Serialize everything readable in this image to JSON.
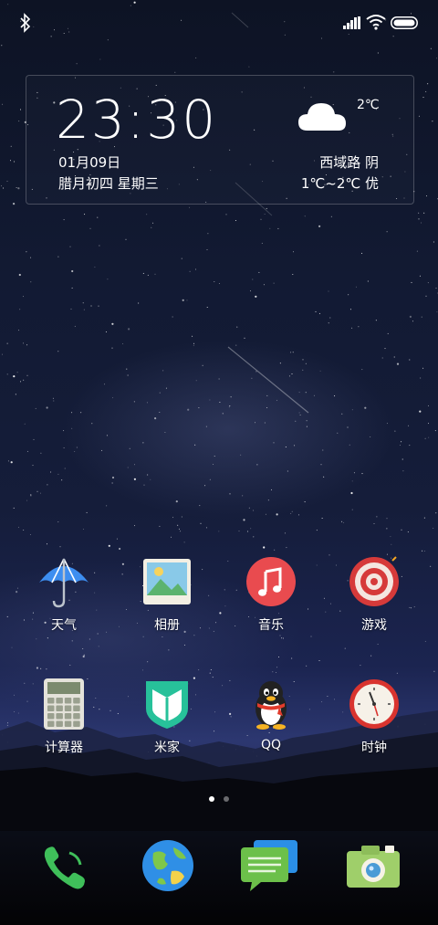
{
  "status_bar": {
    "bluetooth_icon": "bluetooth-icon",
    "signal_icon": "signal-icon",
    "wifi_icon": "wifi-icon",
    "battery_icon": "battery-icon"
  },
  "widget": {
    "time": "23:30",
    "date": "01月09日",
    "lunar": "腊月初四 星期三",
    "temperature": "2℃",
    "location": "西域路 阴",
    "range_quality": "1℃~2℃ 优",
    "weather_icon": "cloud-icon"
  },
  "apps": [
    {
      "label": "天气",
      "icon": "umbrella-icon"
    },
    {
      "label": "相册",
      "icon": "gallery-icon"
    },
    {
      "label": "音乐",
      "icon": "music-icon"
    },
    {
      "label": "游戏",
      "icon": "target-icon"
    },
    {
      "label": "计算器",
      "icon": "calculator-icon"
    },
    {
      "label": "米家",
      "icon": "mijia-icon"
    },
    {
      "label": "QQ",
      "icon": "qq-penguin-icon"
    },
    {
      "label": "时钟",
      "icon": "clock-icon"
    }
  ],
  "page_indicator": {
    "count": 2,
    "active": 1
  },
  "dock": [
    {
      "icon": "phone-icon"
    },
    {
      "icon": "browser-globe-icon"
    },
    {
      "icon": "messages-icon"
    },
    {
      "icon": "camera-icon"
    }
  ],
  "colors": {
    "music": "#e94b4f",
    "target": "#d63a3a",
    "phone": "#3fbf5a",
    "mijia": "#27c19a"
  }
}
